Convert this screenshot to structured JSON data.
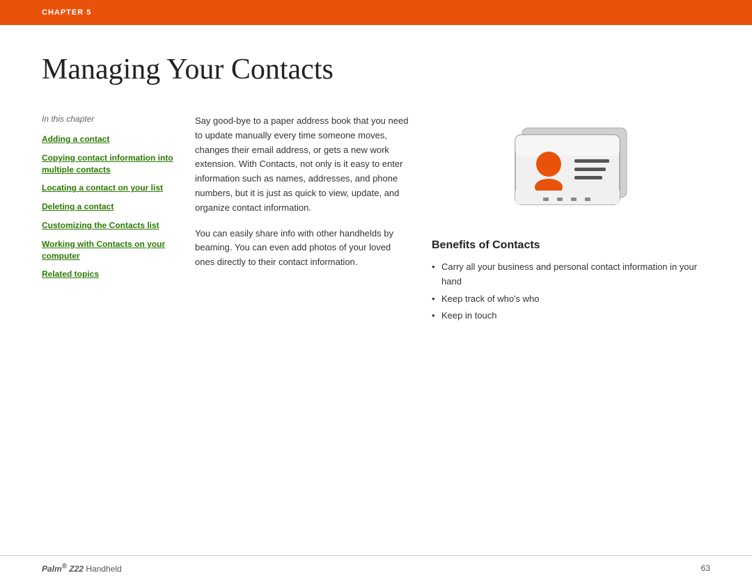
{
  "header": {
    "chapter_label": "CHAPTER 5"
  },
  "page_title": "Managing Your Contacts",
  "left_column": {
    "section_label": "In this chapter",
    "toc_items": [
      {
        "id": "adding-contact",
        "text": "Adding a contact"
      },
      {
        "id": "copying-contact",
        "text": "Copying contact information into multiple contacts"
      },
      {
        "id": "locating-contact",
        "text": "Locating a contact on your list"
      },
      {
        "id": "deleting-contact",
        "text": "Deleting a contact"
      },
      {
        "id": "customizing-contacts",
        "text": "Customizing the Contacts list"
      },
      {
        "id": "working-with-contacts",
        "text": "Working with Contacts on your computer"
      },
      {
        "id": "related-topics",
        "text": "Related topics"
      }
    ]
  },
  "middle_column": {
    "paragraph1": "Say good-bye to a paper address book that you need to update manually every time someone moves, changes their email address, or gets a new work extension. With Contacts, not only is it easy to enter information such as names, addresses, and phone numbers, but it is just as quick to view, update, and organize contact information.",
    "paragraph2": "You can easily share info with other handhelds by beaming. You can even add photos of your loved ones directly to their contact information."
  },
  "right_column": {
    "benefits_title": "Benefits of Contacts",
    "benefits": [
      "Carry all your business and personal contact information in your hand",
      "Keep track of who's who",
      "Keep in touch"
    ]
  },
  "footer": {
    "product": "Palm",
    "product_model": "Z22",
    "product_suffix": " Handheld",
    "page_number": "63"
  }
}
